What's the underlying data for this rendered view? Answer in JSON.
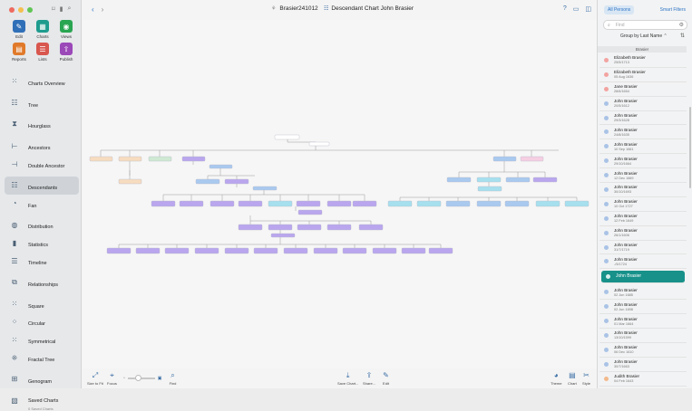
{
  "toolbar_tools": [
    {
      "label": "Edit",
      "icon": "pencil-icon",
      "color": "#2f6fb8"
    },
    {
      "label": "Charts",
      "icon": "charts-icon",
      "color": "#1e9c8e"
    },
    {
      "label": "Views",
      "icon": "eye-icon",
      "color": "#2aa551"
    },
    {
      "label": "Reports",
      "icon": "reports-icon",
      "color": "#e07a2a"
    },
    {
      "label": "Lists",
      "icon": "list-icon",
      "color": "#d8574e"
    },
    {
      "label": "Publish",
      "icon": "publish-icon",
      "color": "#9b48b8"
    }
  ],
  "nav": [
    {
      "label": "Charts Overview",
      "icon": "grid-icon"
    },
    {
      "label": "Tree",
      "icon": "tree-icon"
    },
    {
      "label": "Hourglass",
      "icon": "hourglass-icon"
    },
    {
      "label": "Ancestors",
      "icon": "ancestors-icon"
    },
    {
      "label": "Double Ancestor",
      "icon": "double-ancestor-icon"
    },
    {
      "label": "Descendants",
      "icon": "descendants-icon",
      "active": true
    },
    {
      "label": "Fan",
      "icon": "fan-icon"
    },
    {
      "label": "Distribution",
      "icon": "distribution-icon"
    },
    {
      "label": "Statistics",
      "icon": "statistics-icon"
    },
    {
      "label": "Timeline",
      "icon": "timeline-icon"
    },
    {
      "label": "Relationships",
      "icon": "relationships-icon"
    },
    {
      "label": "Square",
      "icon": "square-icon"
    },
    {
      "label": "Circular",
      "icon": "circular-icon"
    },
    {
      "label": "Symmetrical",
      "icon": "symmetrical-icon"
    },
    {
      "label": "Fractal Tree",
      "icon": "fractal-tree-icon"
    },
    {
      "label": "Genogram",
      "icon": "genogram-icon"
    },
    {
      "label": "Saved Charts",
      "sublabel": "0 Saved Charts",
      "icon": "saved-charts-icon"
    }
  ],
  "header": {
    "document": "Brasier241012",
    "chart_title": "Descendant Chart John Brasier"
  },
  "bottom": {
    "size_to_fit": "Size to Fit",
    "focus": "Focus",
    "find": "Find",
    "save_chart": "Save Chart...",
    "share": "Share...",
    "edit": "Edit",
    "theme": "Theme",
    "chart": "Chart",
    "style": "Style"
  },
  "panel": {
    "tab_all": "All Persons",
    "tab_smart": "Smart Filters",
    "find_placeholder": "Find",
    "group_by": "Group by Last Name",
    "section": "Brasier",
    "persons": [
      {
        "name": "Elizabeth Brasier",
        "date": "25/5/1713",
        "color": "#f2a3a0"
      },
      {
        "name": "Elizabeth Brasier",
        "date": "05 Aug 1636",
        "color": "#f2a3a0"
      },
      {
        "name": "Jane Brasier",
        "date": "28/6/1654",
        "color": "#f2a3a0"
      },
      {
        "name": "John Brasier",
        "date": "20/5/1612",
        "color": "#a9c3e6"
      },
      {
        "name": "John Brasier",
        "date": "29/3/1628",
        "color": "#a9c3e6"
      },
      {
        "name": "John Brasier",
        "date": "24/8/1635",
        "color": "#a9c3e6"
      },
      {
        "name": "John Brasier",
        "date": "10 Sep 1661",
        "color": "#a9c3e6"
      },
      {
        "name": "John Brasier",
        "date": "29/10/1664",
        "color": "#a9c3e6"
      },
      {
        "name": "John Brasier",
        "date": "12 Dec 1669",
        "color": "#a9c3e6"
      },
      {
        "name": "John Brasier",
        "date": "30/10/1693",
        "color": "#a9c3e6"
      },
      {
        "name": "John Brasier",
        "date": "10 Oct 1727",
        "color": "#a9c3e6"
      },
      {
        "name": "John Brasier",
        "date": "12 Feb 1649",
        "color": "#a9c3e6"
      },
      {
        "name": "John Brasier",
        "date": "26/1/1606",
        "color": "#a9c3e6"
      },
      {
        "name": "John Brasier",
        "date": "31/7/1719",
        "color": "#a9c3e6"
      },
      {
        "name": "John Brasier",
        "date": "-/5/1724",
        "color": "#a9c3e6"
      },
      {
        "name": "John Brasier",
        "date": "",
        "color": "#a9c3e6",
        "selected": true
      },
      {
        "name": "John Brasier",
        "date": "02 Jun 1685",
        "color": "#a9c3e6"
      },
      {
        "name": "John Brasier",
        "date": "02 Jun 1698",
        "color": "#a9c3e6"
      },
      {
        "name": "John Brasier",
        "date": "01 Mar 1664",
        "color": "#a9c3e6"
      },
      {
        "name": "John Brasier",
        "date": "13/10/1599",
        "color": "#a9c3e6"
      },
      {
        "name": "John Brasier",
        "date": "06 Dec 1610",
        "color": "#a9c3e6"
      },
      {
        "name": "John Brasier",
        "date": "30/7/1663",
        "color": "#a9c3e6"
      },
      {
        "name": "Judith Brasier",
        "date": "04 Feb 1643",
        "color": "#f2b98c"
      }
    ]
  }
}
